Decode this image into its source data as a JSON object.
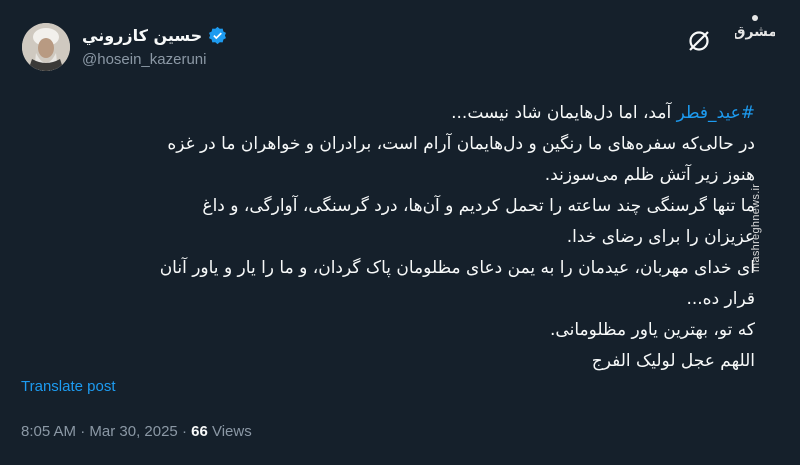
{
  "colors": {
    "background": "#15202b",
    "text_primary": "#f7f9f9",
    "text_secondary": "#8b98a5",
    "accent": "#1d9bf0"
  },
  "author": {
    "name": "حسين كازروني",
    "handle": "@hosein_kazeruni",
    "verified_icon": "verified-badge-icon",
    "avatar": "profile-photo"
  },
  "header_icons": {
    "grok_icon": "grok-icon"
  },
  "watermark": {
    "logo_text": "مشرق",
    "site": "mashreghnews.ir"
  },
  "tweet": {
    "hashtag": "#عید_فطر",
    "lines": [
      " آمد، اما دل‌هایمان شاد نیست...",
      "در حالی‌که سفره‌های ما رنگین و دل‌هایمان آرام است، برادران و خواهران ما در غزه",
      "هنوز زیر آتش ظلم می‌سوزند.",
      "ما تنها گرسنگی چند ساعته را تحمل کردیم و آن‌ها، درد گرسنگی، آوارگی، و داغ",
      "عزیزان را برای رضای خدا.",
      "ای خدای مهربان، عیدمان را به یمن دعای مظلومان پاک گردان، و ما را یار و یاور آنان",
      "قرار ده...",
      "که تو، بهترین یاور مظلومانی.",
      "اللهم عجل لولیک الفرج"
    ]
  },
  "translate_label": "Translate post",
  "meta": {
    "time": "8:05 AM",
    "separator": " · ",
    "date": "Mar 30, 2025",
    "views_count": "66",
    "views_label": " Views"
  }
}
